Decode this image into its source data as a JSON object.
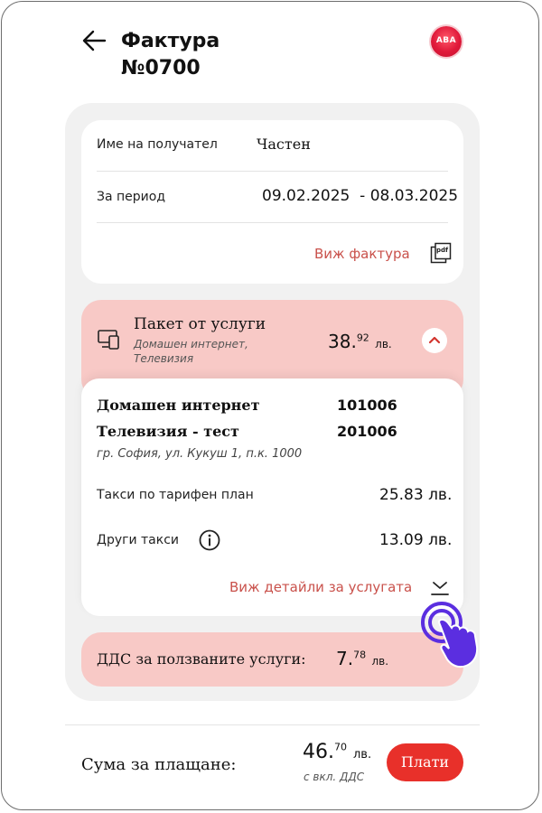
{
  "header": {
    "title_line1": "Фактура",
    "title_line2": "№0700",
    "logo_text": "ABA"
  },
  "invoice": {
    "recipient_label": "Име на получател",
    "recipient_value": "Частен",
    "period_label": "За период",
    "period_from": "09.02.2025",
    "period_to": "- 08.03.2025",
    "view_invoice_link": "Виж фактура",
    "pdf_icon_text": "pdf"
  },
  "package": {
    "title": "Пакет от услуги",
    "subtitle_line1": "Домашен интернет,",
    "subtitle_line2": "Телевизия",
    "price_int": "38.",
    "price_dec": "92",
    "currency": "лв."
  },
  "services": {
    "items": [
      {
        "name": "Домашен интернет",
        "code": "101006"
      },
      {
        "name": "Телевизия - тест",
        "code": "201006"
      }
    ],
    "address": "гр. София, ул. Кукуш 1, п.к. 1000",
    "tariff_label": "Такси по тарифен план",
    "tariff_value": "25.83 лв.",
    "other_label": "Други такси",
    "other_value": "13.09 лв.",
    "details_link": "Виж детайли за услугата"
  },
  "vat": {
    "label": "ДДС за ползваните услуги:",
    "price_int": "7.",
    "price_dec": "78",
    "currency": "лв."
  },
  "total": {
    "label": "Сума за плащане:",
    "price_int": "46.",
    "price_dec": "70",
    "currency": "лв.",
    "note": "с вкл. ДДС",
    "pay_button": "Плати"
  },
  "colors": {
    "accent": "#e8302a",
    "pink": "#f8c9c6",
    "link": "#c9514b",
    "cursor": "#5b2ee0"
  }
}
